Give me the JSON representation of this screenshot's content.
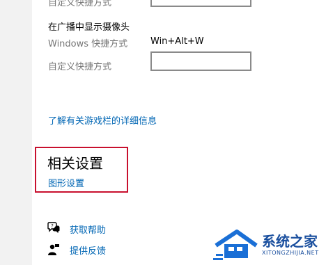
{
  "settings": {
    "prev_field_label": "自定义快捷方式",
    "broadcast_camera": {
      "heading": "在广播中显示摄像头",
      "windows_shortcut_label": "Windows 快捷方式",
      "windows_shortcut_value": "Win+Alt+W",
      "custom_shortcut_label": "自定义快捷方式",
      "custom_shortcut_value": ""
    },
    "learn_more_link": "了解有关游戏栏的详细信息"
  },
  "related": {
    "title": "相关设置",
    "graphics_link": "图形设置"
  },
  "help": {
    "get_help": "获取帮助",
    "feedback": "提供反馈"
  },
  "watermark": {
    "brand": "系统之家",
    "url": "XITONGZHIJIA.NET"
  },
  "colors": {
    "link": "#0066b4",
    "highlight_box": "#c8102e",
    "watermark_blue": "#1a6fd6"
  }
}
